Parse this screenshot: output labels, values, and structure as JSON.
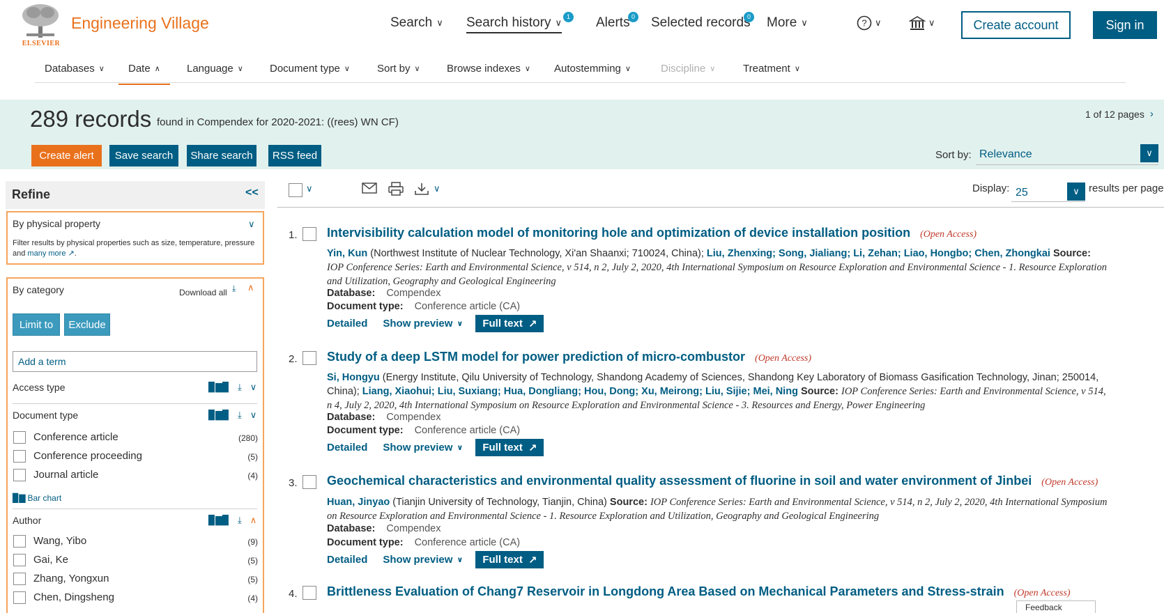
{
  "brand": {
    "name": "Engineering Village",
    "publisher": "ELSEVIER"
  },
  "topnav": {
    "search": "Search",
    "search_history": "Search history",
    "search_history_badge": "1",
    "alerts": "Alerts",
    "alerts_badge": "0",
    "selected_records": "Selected records",
    "selected_records_badge": "0",
    "more": "More",
    "create_account": "Create account",
    "sign_in": "Sign in"
  },
  "filters": {
    "databases": "Databases",
    "date": "Date",
    "language": "Language",
    "document_type": "Document type",
    "sort_by": "Sort by",
    "browse_indexes": "Browse indexes",
    "autostemming": "Autostemming",
    "discipline": "Discipline",
    "treatment": "Treatment"
  },
  "results_header": {
    "count": "289 records",
    "description": "found in Compendex for 2020-2021: ((rees) WN CF)",
    "pages": "1 of 12 pages",
    "create_alert": "Create alert",
    "save_search": "Save search",
    "share_search": "Share search",
    "rss_feed": "RSS feed",
    "sort_by_label": "Sort by:",
    "sort_by_value": "Relevance"
  },
  "toolbar": {
    "display_label": "Display:",
    "display_value": "25",
    "display_tail": "results per page"
  },
  "sidebar": {
    "title": "Refine",
    "collapse": "<<",
    "physical": {
      "title": "By physical property",
      "desc": "Filter results by physical properties such as size, temperature, pressure and",
      "more_link": "many more",
      "dot": "."
    },
    "category": {
      "title": "By category",
      "download_all": "Download all",
      "limit_to": "Limit to",
      "exclude": "Exclude",
      "add_term_placeholder": "Add a term",
      "access_type": "Access type",
      "document_type": "Document type",
      "doc_types": [
        {
          "label": "Conference article",
          "count": "(280)"
        },
        {
          "label": "Conference proceeding",
          "count": "(5)"
        },
        {
          "label": "Journal article",
          "count": "(4)"
        }
      ],
      "bar_chart": "Bar chart",
      "author": "Author",
      "authors": [
        {
          "label": "Wang, Yibo",
          "count": "(9)"
        },
        {
          "label": "Gai, Ke",
          "count": "(5)"
        },
        {
          "label": "Zhang, Yongxun",
          "count": "(5)"
        },
        {
          "label": "Chen, Dingsheng",
          "count": "(4)"
        }
      ]
    }
  },
  "results": [
    {
      "num": "1.",
      "title": "Intervisibility calculation model of monitoring hole and optimization of device installation position",
      "open_access": "(Open Access)",
      "database_label": "Database:",
      "database": "Compendex",
      "doctype_label": "Document type:",
      "doctype": "Conference article (CA)",
      "detailed": "Detailed",
      "preview": "Show preview",
      "fulltext": "Full text"
    },
    {
      "num": "2.",
      "title": "Study of a deep LSTM model for power prediction of micro-combustor",
      "open_access": "(Open Access)",
      "database_label": "Database:",
      "database": "Compendex",
      "doctype_label": "Document type:",
      "doctype": "Conference article (CA)",
      "detailed": "Detailed",
      "preview": "Show preview",
      "fulltext": "Full text"
    },
    {
      "num": "3.",
      "title": "Geochemical characteristics and environmental quality assessment of fluorine in soil and water environment of Jinbei",
      "open_access": "(Open Access)",
      "database_label": "Database:",
      "database": "Compendex",
      "doctype_label": "Document type:",
      "doctype": "Conference article (CA)",
      "detailed": "Detailed",
      "preview": "Show preview",
      "fulltext": "Full text"
    },
    {
      "num": "4.",
      "title": "Brittleness Evaluation of Chang7 Reservoir in Longdong Area Based on Mechanical Parameters and Stress-strain",
      "open_access": "(Open Access)"
    }
  ],
  "r1_meta": {
    "a1": "Yin, Kun",
    "aff1": "(Northwest Institute of Nuclear Technology, Xi'an Shaanxi; 710024, China);",
    "a2": "Liu, Zhenxing;",
    "a3": "Song, Jialiang;",
    "a4": "Li, Zehan;",
    "a5": "Liao, Hongbo;",
    "a6": "Chen, Zhongkai",
    "source_label": "Source:",
    "source": "IOP Conference Series: Earth and Environmental Science, v 514, n 2, July 2, 2020, 4th International Symposium on Resource Exploration and Environmental Science - 1. Resource Exploration and Utilization, Geography and Geological Engineering"
  },
  "r2_meta": {
    "a1": "Si, Hongyu",
    "aff1": "(Energy Institute, Qilu University of Technology, Shandong Academy of Sciences, Shandong Key Laboratory of Biomass Gasification Technology, Jinan; 250014, China);",
    "a2": "Liang, Xiaohui;",
    "a3": "Liu, Suxiang;",
    "a4": "Hua, Dongliang;",
    "a5": "Hou, Dong;",
    "a6": "Xu, Meirong;",
    "a7": "Liu, Sijie;",
    "a8": "Mei, Ning",
    "source_label": "Source:",
    "source": "IOP Conference Series: Earth and Environmental Science, v 514, n 4, July 2, 2020, 4th International Symposium on Resource Exploration and Environmental Science - 3. Resources and Energy, Power Engineering"
  },
  "r3_meta": {
    "a1": "Huan, Jinyao",
    "aff1": "(Tianjin University of Technology, Tianjin, China)",
    "source_label": "Source:",
    "source": "IOP Conference Series: Earth and Environmental Science, v 514, n 2, July 2, 2020, 4th International Symposium on Resource Exploration and Environmental Science - 1. Resource Exploration and Utilization, Geography and Geological Engineering"
  },
  "feedback": "Feedback",
  "colors": {
    "brand_orange": "#e9711c",
    "primary_blue": "#005d83",
    "band": "#e1f1ee",
    "open_access": "#c0392b"
  }
}
